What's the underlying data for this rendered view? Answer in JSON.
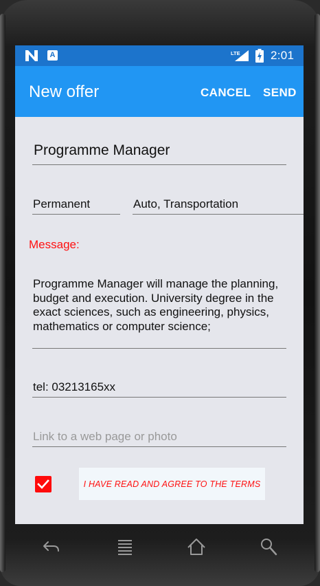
{
  "statusbar": {
    "time": "2:01",
    "network": "LTE",
    "notification_icons": [
      "n-icon",
      "a-icon"
    ]
  },
  "appbar": {
    "title": "New offer",
    "cancel_label": "CANCEL",
    "send_label": "SEND"
  },
  "form": {
    "title_value": "Programme Manager",
    "job_type_value": "Permanent",
    "category_value": "Auto, Transportation",
    "message_label": "Message:",
    "message_value": "Programme Manager will manage the planning, budget and execution. University degree in the exact sciences, such as engineering, physics, mathematics or computer science;",
    "phone_value": "tel: 03213165xx",
    "link_placeholder": "Link to a web page or photo",
    "terms_checked": true,
    "terms_label": "I HAVE READ AND AGREE TO THE TERMS"
  },
  "navbar": {
    "icons": [
      "back-icon",
      "menu-icon",
      "home-icon",
      "search-icon"
    ]
  },
  "colors": {
    "statusbar": "#1c74cc",
    "appbar": "#2196f3",
    "accent_red": "#ff0a0a",
    "background": "#e5e6ec"
  }
}
